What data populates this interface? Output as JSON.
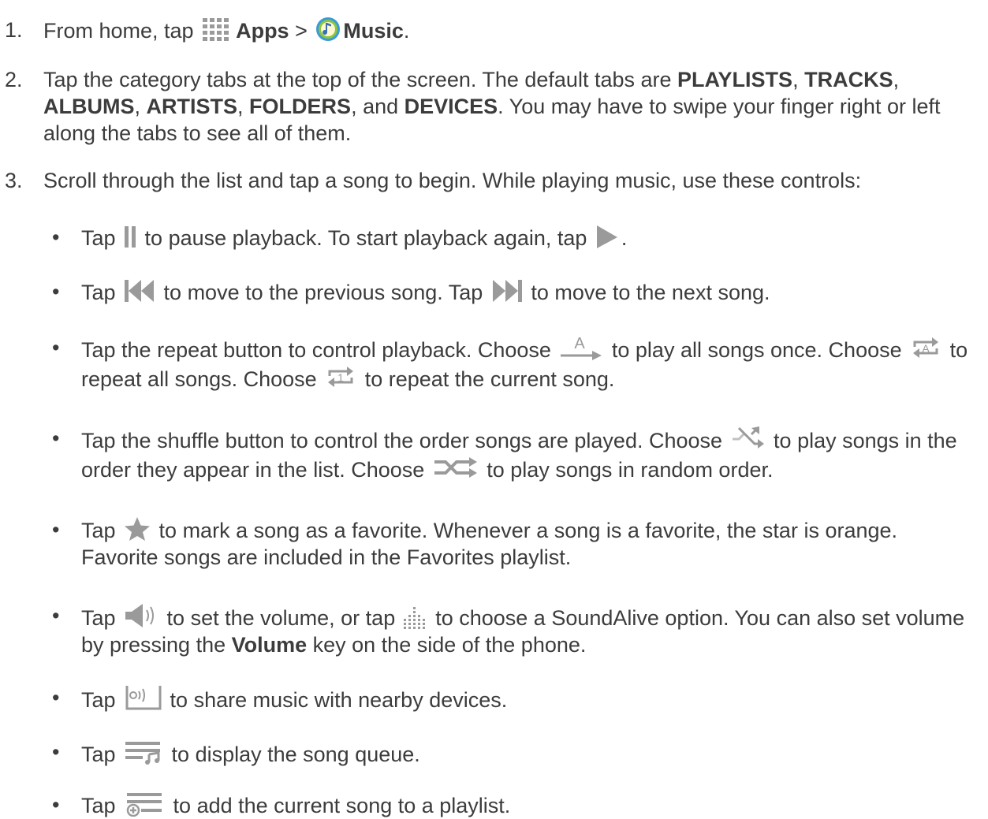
{
  "steps": [
    {
      "num": "1.",
      "t1": "From home, tap ",
      "b1": "Apps",
      "t2": " > ",
      "b2": "Music",
      "t3": "."
    },
    {
      "num": "2.",
      "t1": "Tap the category tabs at the top of the screen. The default tabs are ",
      "b1": "PLAYLISTS",
      "s1": ", ",
      "b2": "TRACKS",
      "s2": ", ",
      "b3": "ALBUMS",
      "s3": ", ",
      "b4": "ARTISTS",
      "s4": ", ",
      "b5": "FOLDERS",
      "s5": ", and ",
      "b6": "DEVICES",
      "t2": ". You may have to swipe your finger right or left along the tabs to see all of them."
    },
    {
      "num": "3.",
      "text": "Scroll through the list and tap a song to begin. While playing music, use these controls:"
    }
  ],
  "bullets": {
    "dot": "•",
    "pause": {
      "a": "Tap ",
      "b": " to pause playback. To start playback again, tap ",
      "c": "."
    },
    "skip": {
      "a": "Tap ",
      "b": " to move to the previous song. Tap ",
      "c": " to move to the next song."
    },
    "repeat": {
      "a": "Tap the repeat button to control playback. Choose ",
      "b": " to play all songs once. Choose ",
      "c": " to repeat all songs. Choose ",
      "d": " to repeat the current song."
    },
    "shuffle": {
      "a": "Tap the shuffle button to control the order songs are played. Choose ",
      "b": " to play songs in the order they appear in the list. Choose ",
      "c": " to play songs in random order."
    },
    "favorite": {
      "a": "Tap ",
      "b": " to mark a song as a favorite. Whenever a song is a favorite, the star is orange. Favorite songs are included in the Favorites playlist."
    },
    "volume": {
      "a": "Tap ",
      "b": " to set the volume, or tap ",
      "c": " to choose a SoundAlive option. You can also set volume by pressing the ",
      "d": "Volume",
      "e": " key on the side of the phone."
    },
    "share": {
      "a": "Tap ",
      "b": " to share music with nearby devices."
    },
    "queue": {
      "a": "Tap ",
      "b": " to display the song queue."
    },
    "playlist": {
      "a": "Tap ",
      "b": " to add the current song to a playlist."
    }
  },
  "icons": {
    "apps": "apps-grid-icon",
    "music": "music-app-icon",
    "pause": "pause-icon",
    "play": "play-icon",
    "previous": "previous-icon",
    "next": "next-icon",
    "repeat_off": "repeat-once-icon",
    "repeat_all": "repeat-all-icon",
    "repeat_one": "repeat-one-icon",
    "shuffle_off": "shuffle-off-icon",
    "shuffle_on": "shuffle-on-icon",
    "star": "favorite-star-icon",
    "volume": "volume-icon",
    "soundalive": "soundalive-icon",
    "share": "share-devices-icon",
    "queue": "song-queue-icon",
    "add_playlist": "add-to-playlist-icon",
    "repeat_letter": "A",
    "repeat_one_digit": "1"
  },
  "colors": {
    "text": "#3c3c3c",
    "icon_gray": "#9a9a9a",
    "music_green": "#8cc63f",
    "music_blue": "#3a9ad9"
  }
}
